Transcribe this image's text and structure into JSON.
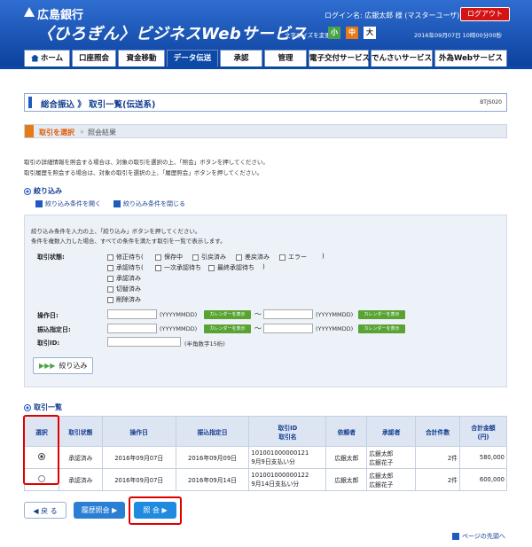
{
  "header": {
    "bank_name": "広島銀行",
    "service_name": "〈ひろぎん〉ビジネスWebサービス",
    "login_info": "ログイン名: 広銀太郎 様 (マスターユーザ)",
    "logout_label": "ログアウト",
    "font_size_label": "文字サイズを変更",
    "font_sizes": [
      "小",
      "中",
      "大"
    ],
    "datetime": "2016年09月07日 10時00分00秒",
    "colors": {
      "header_blue": "#0d4aa8",
      "logout_red": "#d41414",
      "small_green": "#4aa34a",
      "medium_orange": "#e67a14"
    }
  },
  "nav": {
    "tabs": [
      {
        "icon": "home-icon",
        "label": "ホーム"
      },
      {
        "label": "口座照会"
      },
      {
        "label": "資金移動"
      },
      {
        "label": "データ伝送",
        "active": true
      },
      {
        "label": "承認"
      },
      {
        "label": "管理"
      },
      {
        "label": "電子交付サービス"
      },
      {
        "label": "でんさいサービス"
      },
      {
        "label": "外為Webサービス"
      }
    ]
  },
  "page": {
    "title": "総合振込 》 取引一覧(伝送系)",
    "screen_id": "BTJS020",
    "step_current": "取引を選択",
    "step_sep": "»",
    "step_next": "照会結果",
    "intro_1": "取引の詳細情報を照会する場合は、対象の取引を選択の上、「照会」ボタンを押してください。",
    "intro_2": "取引履歴を照会する場合は、対象の取引を選択の上、「履歴照会」ボタンを押してください。"
  },
  "filter": {
    "section_title": "絞り込み",
    "open_link": "絞り込み条件を開く",
    "close_link": "絞り込み条件を閉じる",
    "desc_1": "絞り込み条件を入力の上、「絞り込み」ボタンを押してください。",
    "desc_2": "条件を複数入力した場合、すべての条件を満たす取引を一覧で表示します。",
    "status_label": "取引状態:",
    "paren_open_1": "修正待ち(",
    "paren_open_2": "承認待ち(",
    "paren_close": ")",
    "status_row1": [
      "保存中",
      "引戻済み",
      "差戻済み",
      "エラー"
    ],
    "status_row2": [
      "一次承認待ち",
      "最終承認待ち"
    ],
    "status_single": [
      "承認済み",
      "切替済み",
      "削除済み"
    ],
    "op_date_label": "操作日:",
    "transfer_date_label": "振込指定日:",
    "trade_id_label": "取引ID:",
    "date_hint": "(YYYYMMDD)",
    "calendar_label": "カレンダーを表示",
    "tilde": "～",
    "id_hint": "(半角数字15桁)",
    "search_label": "絞り込み"
  },
  "results": {
    "section_title": "取引一覧",
    "headers": [
      "選択",
      "取引状態",
      "操作日",
      "振込指定日",
      "取引ID\n取引名",
      "依頼者",
      "承認者",
      "合計件数",
      "合計金額\n(円)"
    ],
    "rows": [
      {
        "selected": true,
        "status": "承認済み",
        "op_date": "2016年09月07日",
        "transfer_date": "2016年09月09日",
        "trade_id": "101001000000121",
        "trade_name": "9月9日支払い分",
        "requester": "広銀太郎",
        "approver_1": "広銀太郎",
        "approver_2": "広銀花子",
        "count": "2件",
        "amount": "580,000"
      },
      {
        "selected": false,
        "status": "承認済み",
        "op_date": "2016年09月07日",
        "transfer_date": "2016年09月14日",
        "trade_id": "101001000000122",
        "trade_name": "9月14日支払い分",
        "requester": "広銀太郎",
        "approver_1": "広銀太郎",
        "approver_2": "広銀花子",
        "count": "2件",
        "amount": "600,000"
      }
    ]
  },
  "buttons": {
    "back_label": "戻 る",
    "history_label": "履歴照会",
    "inquiry_label": "照 会"
  },
  "footer": {
    "page_top_label": "ページの先頭へ"
  }
}
